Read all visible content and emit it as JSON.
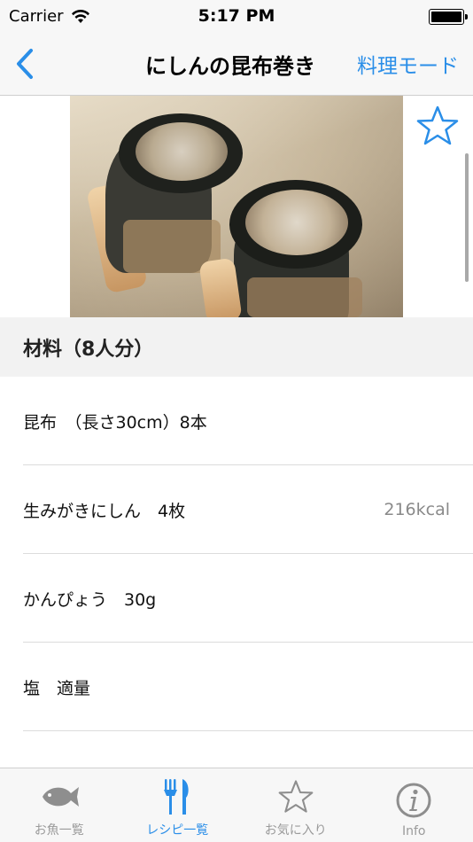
{
  "status_bar": {
    "carrier": "Carrier",
    "time": "5:17 PM"
  },
  "nav": {
    "title": "にしんの昆布巻き",
    "right_button": "料理モード",
    "back_icon": "chevron-left-icon",
    "accent_color": "#2a8ee8"
  },
  "recipe": {
    "favorite_icon": "star-outline-icon",
    "section_title": "材料（8人分）",
    "ingredients": [
      {
        "name": "昆布　（長さ30cm）8本",
        "cal": ""
      },
      {
        "name": "生みがきにしん　4枚",
        "cal": "216kcal"
      },
      {
        "name": "かんぴょう　30g",
        "cal": ""
      },
      {
        "name": "塩　適量",
        "cal": ""
      }
    ]
  },
  "tabs": [
    {
      "label": "お魚一覧",
      "icon": "fish-icon",
      "active": false
    },
    {
      "label": "レシピ一覧",
      "icon": "fork-knife-icon",
      "active": true
    },
    {
      "label": "お気に入り",
      "icon": "star-icon",
      "active": false
    },
    {
      "label": "Info",
      "icon": "info-icon",
      "active": false
    }
  ]
}
